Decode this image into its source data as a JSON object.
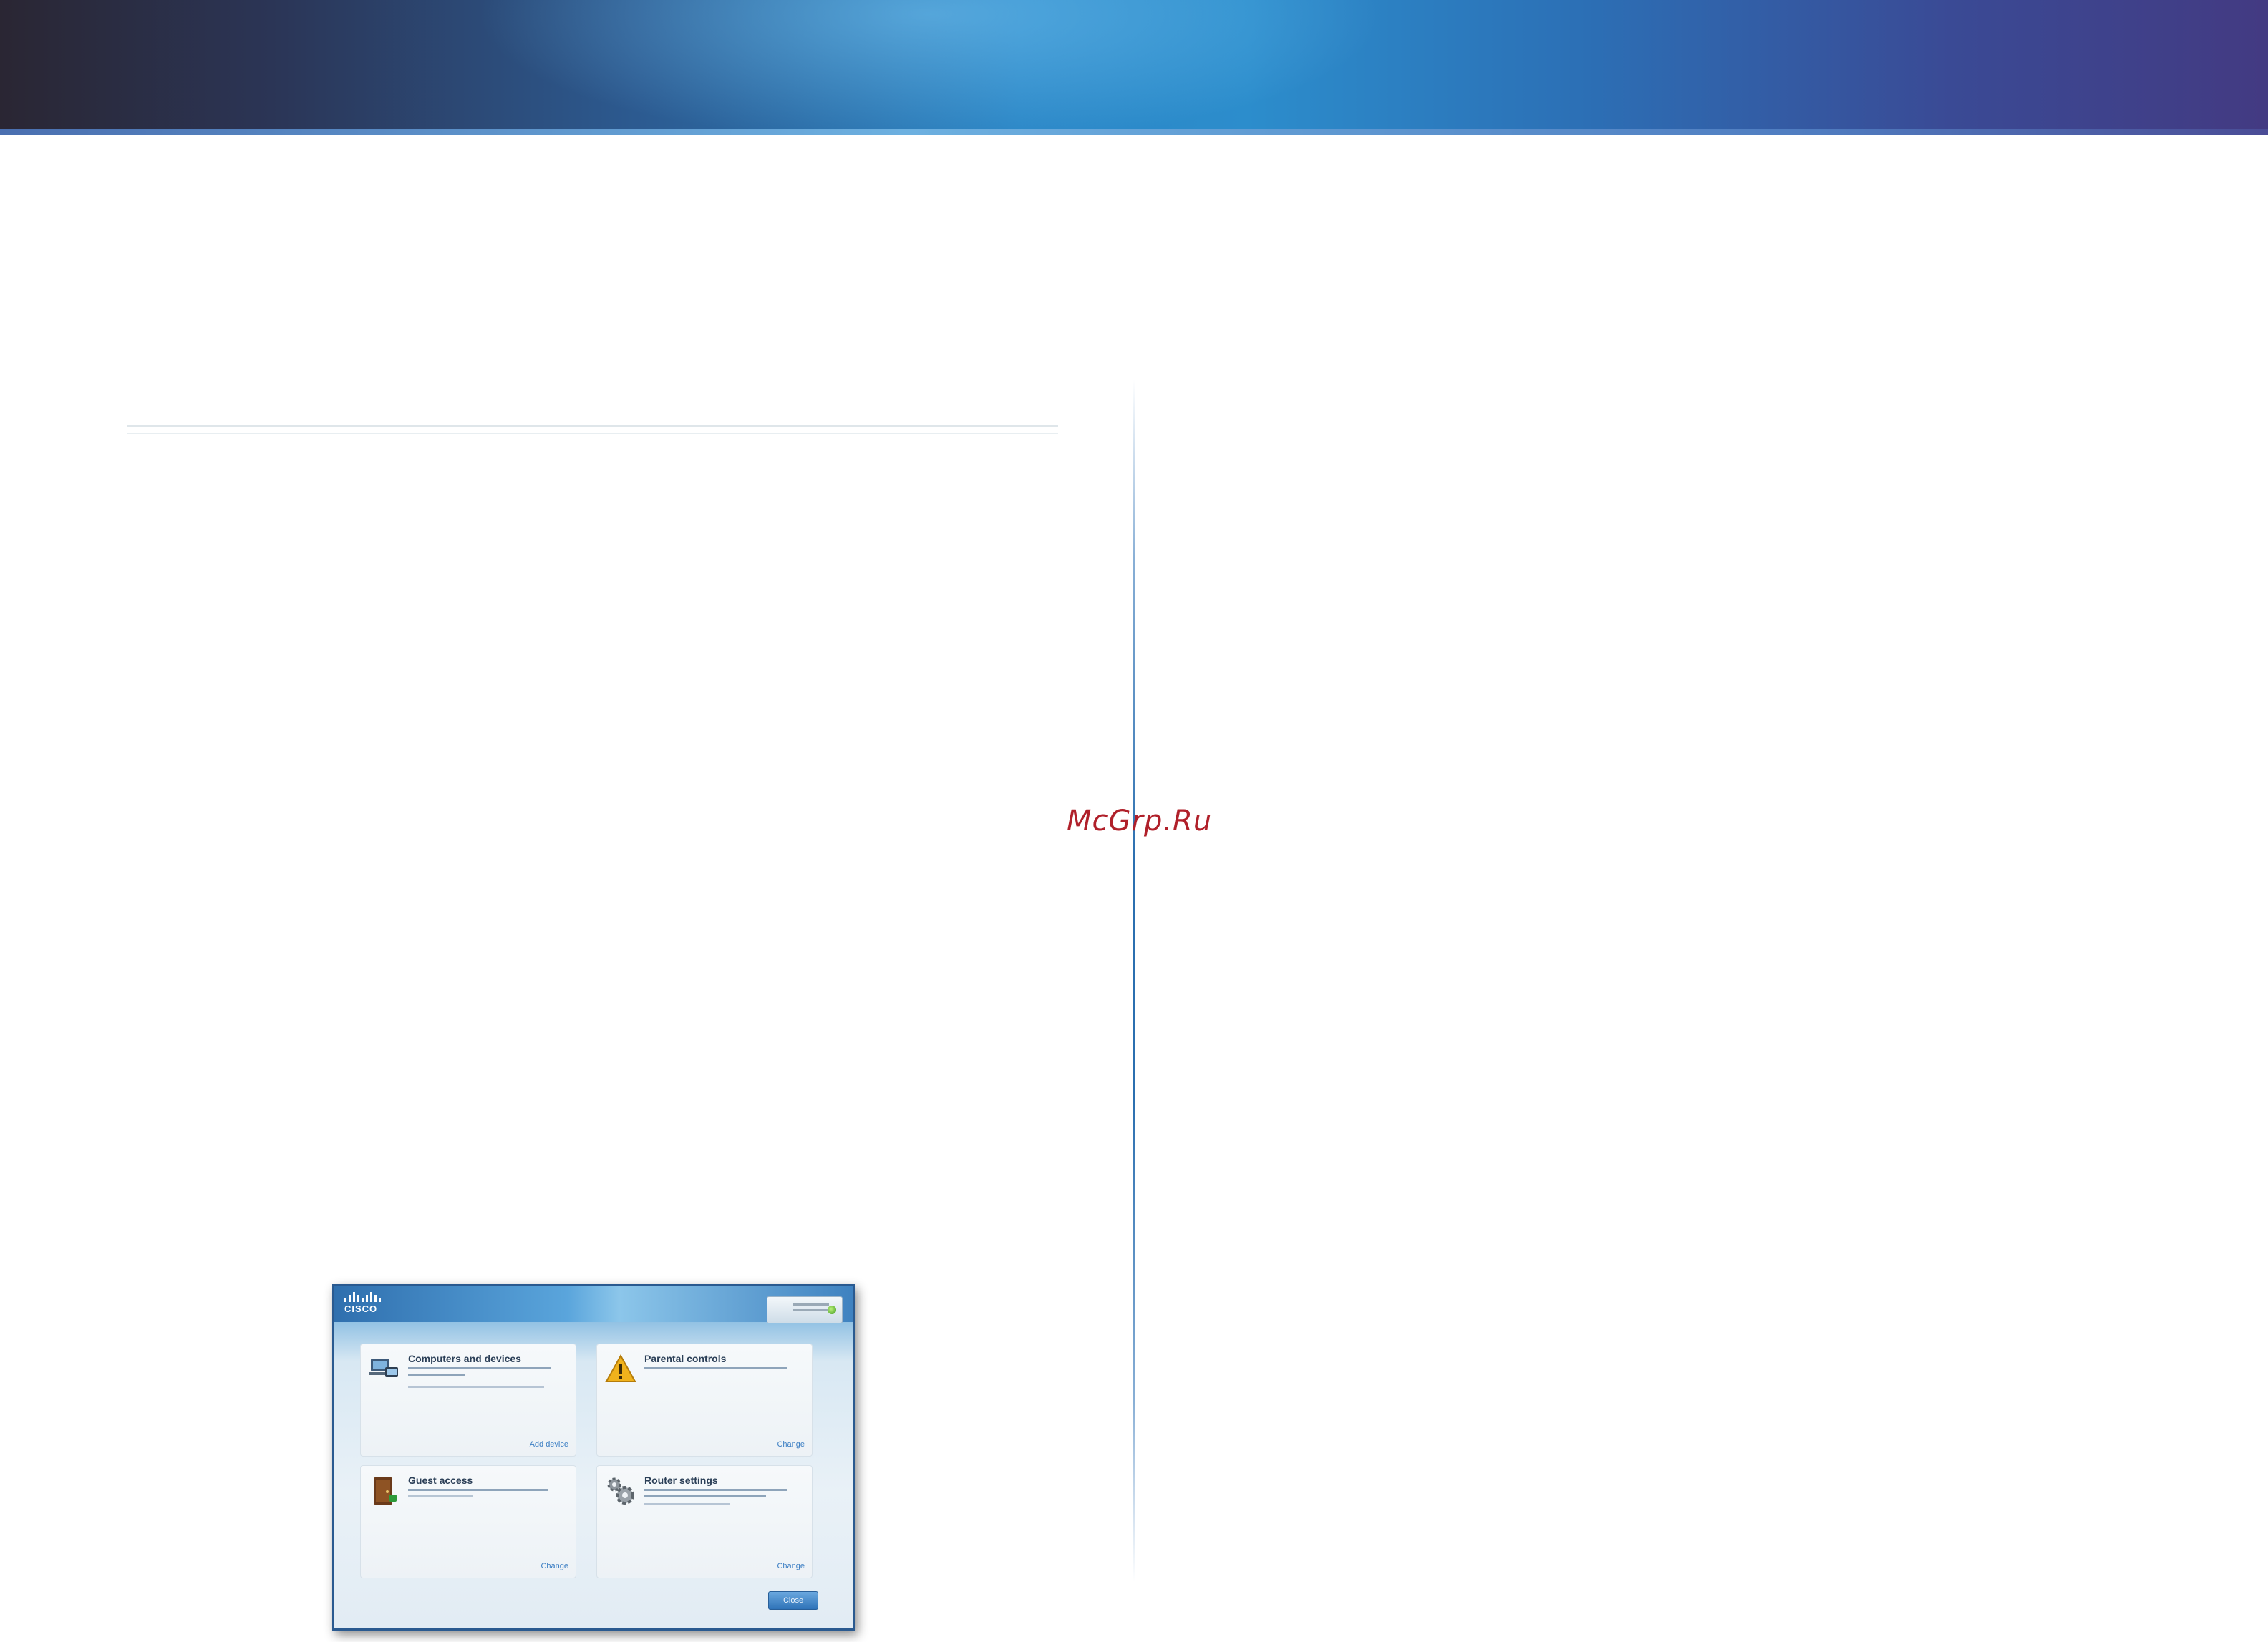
{
  "watermark": "McGrp.Ru",
  "screenshot": {
    "logo_text": "CISCO",
    "panels": [
      {
        "title": "Computers and devices",
        "link": "Add device"
      },
      {
        "title": "Parental controls",
        "link": "Change"
      },
      {
        "title": "Guest access",
        "link": "Change"
      },
      {
        "title": "Router settings",
        "link": "Change"
      }
    ],
    "close_label": "Close"
  },
  "icons": [
    "computers-icon",
    "warning-icon",
    "guest-access-icon",
    "gears-icon",
    "status-indicator-icon"
  ]
}
